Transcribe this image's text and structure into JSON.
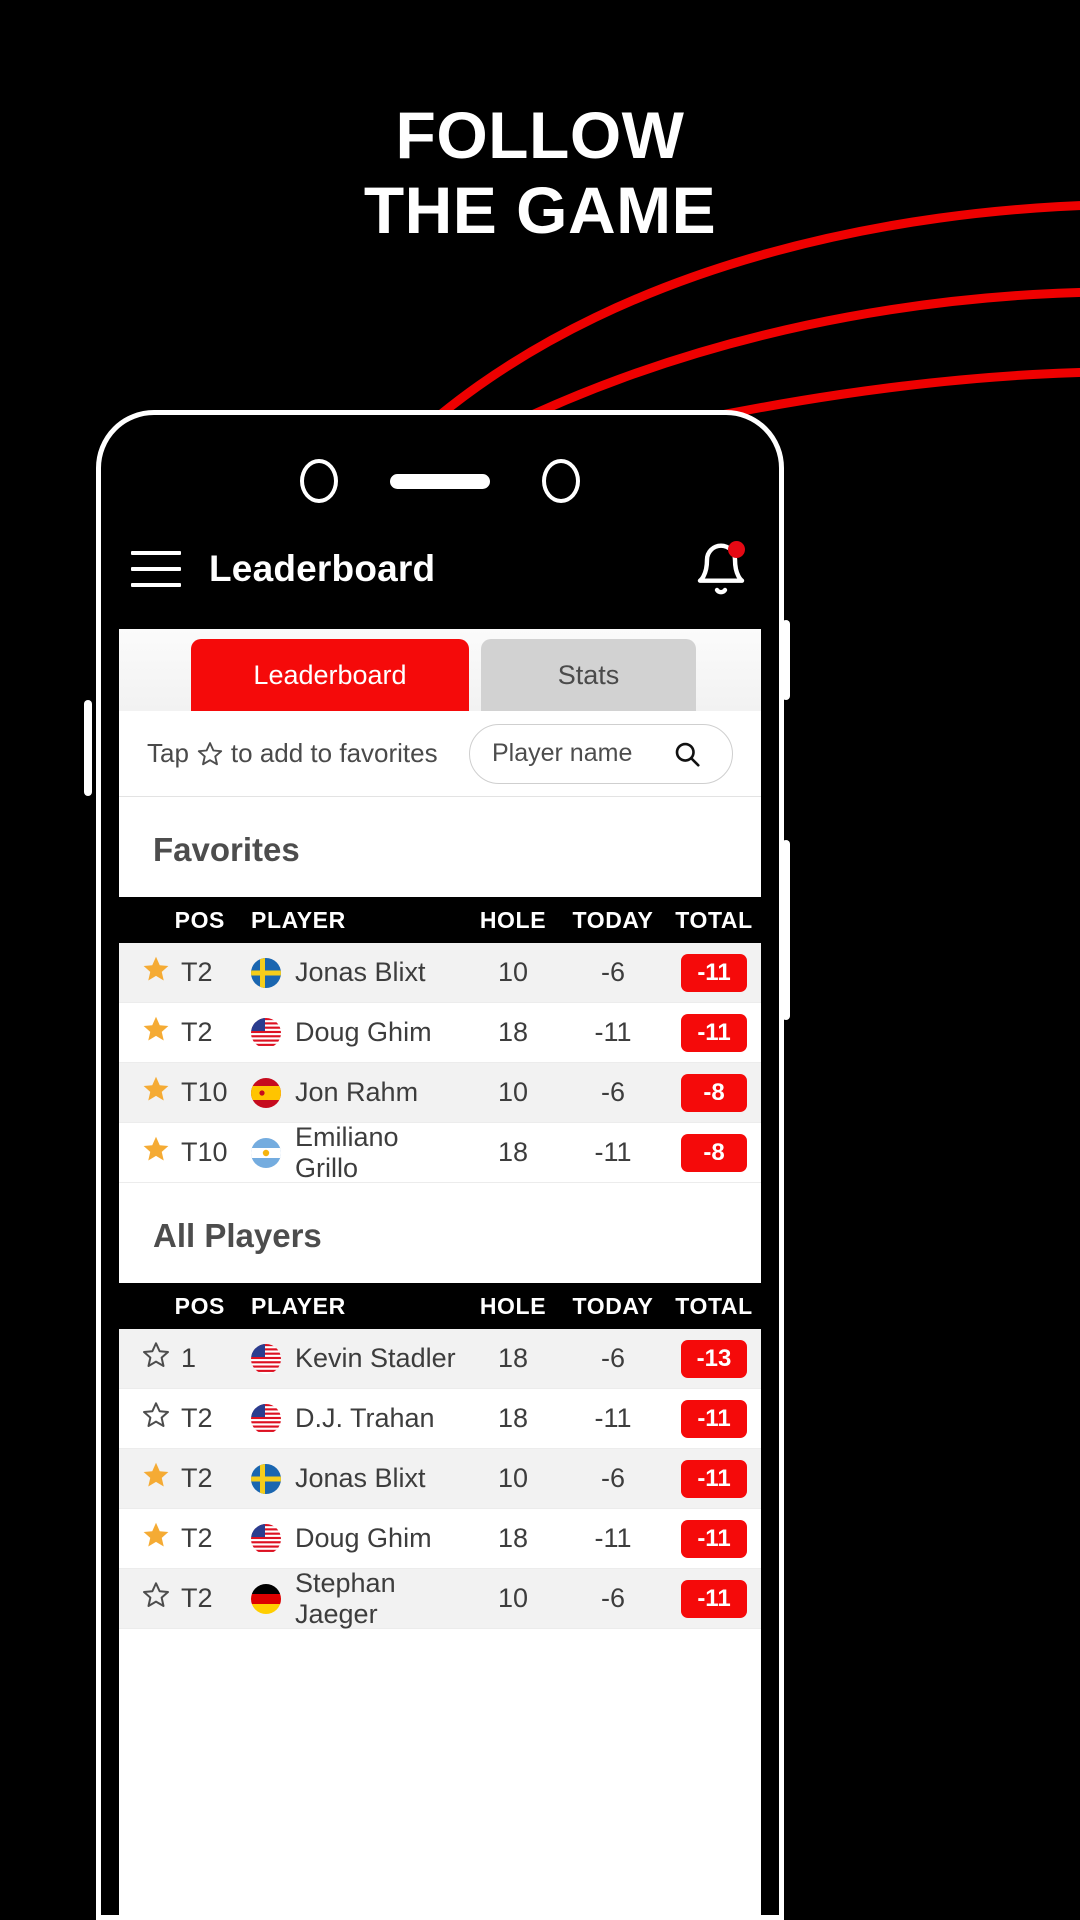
{
  "promo": {
    "line1": "FOLLOW",
    "line2": "THE GAME"
  },
  "brand": {
    "accent": "#f50a0a",
    "star_on": "#f5ab34",
    "star_off": "#4d4d4d"
  },
  "app": {
    "header": {
      "menu_icon": "hamburger-icon",
      "title": "Leaderboard",
      "bell_icon": "bell-icon",
      "has_notification": true
    },
    "tabs": [
      {
        "label": "Leaderboard",
        "active": true
      },
      {
        "label": "Stats",
        "active": false
      }
    ],
    "toolbar": {
      "hint_prefix": "Tap",
      "hint_suffix": "to add to favorites",
      "star_icon": "star-outline-icon",
      "search_placeholder": "Player name",
      "search_value": "",
      "search_icon": "search-icon"
    },
    "columns": [
      "POS",
      "PLAYER",
      "HOLE",
      "TODAY",
      "TOTAL"
    ],
    "sections": [
      {
        "title": "Favorites",
        "rows": [
          {
            "fav": true,
            "pos": "T2",
            "flag": "se",
            "player": "Jonas Blixt",
            "hole": "10",
            "today": "-6",
            "total": "-11"
          },
          {
            "fav": true,
            "pos": "T2",
            "flag": "us",
            "player": "Doug Ghim",
            "hole": "18",
            "today": "-11",
            "total": "-11"
          },
          {
            "fav": true,
            "pos": "T10",
            "flag": "es",
            "player": "Jon Rahm",
            "hole": "10",
            "today": "-6",
            "total": "-8"
          },
          {
            "fav": true,
            "pos": "T10",
            "flag": "ar",
            "player": "Emiliano Grillo",
            "hole": "18",
            "today": "-11",
            "total": "-8"
          }
        ]
      },
      {
        "title": "All Players",
        "rows": [
          {
            "fav": false,
            "pos": "1",
            "flag": "us",
            "player": "Kevin Stadler",
            "hole": "18",
            "today": "-6",
            "total": "-13"
          },
          {
            "fav": false,
            "pos": "T2",
            "flag": "us",
            "player": "D.J. Trahan",
            "hole": "18",
            "today": "-11",
            "total": "-11"
          },
          {
            "fav": true,
            "pos": "T2",
            "flag": "se",
            "player": "Jonas Blixt",
            "hole": "10",
            "today": "-6",
            "total": "-11"
          },
          {
            "fav": true,
            "pos": "T2",
            "flag": "us",
            "player": "Doug Ghim",
            "hole": "18",
            "today": "-11",
            "total": "-11"
          },
          {
            "fav": false,
            "pos": "T2",
            "flag": "de",
            "player": "Stephan Jaeger",
            "hole": "10",
            "today": "-6",
            "total": "-11"
          }
        ]
      }
    ]
  }
}
